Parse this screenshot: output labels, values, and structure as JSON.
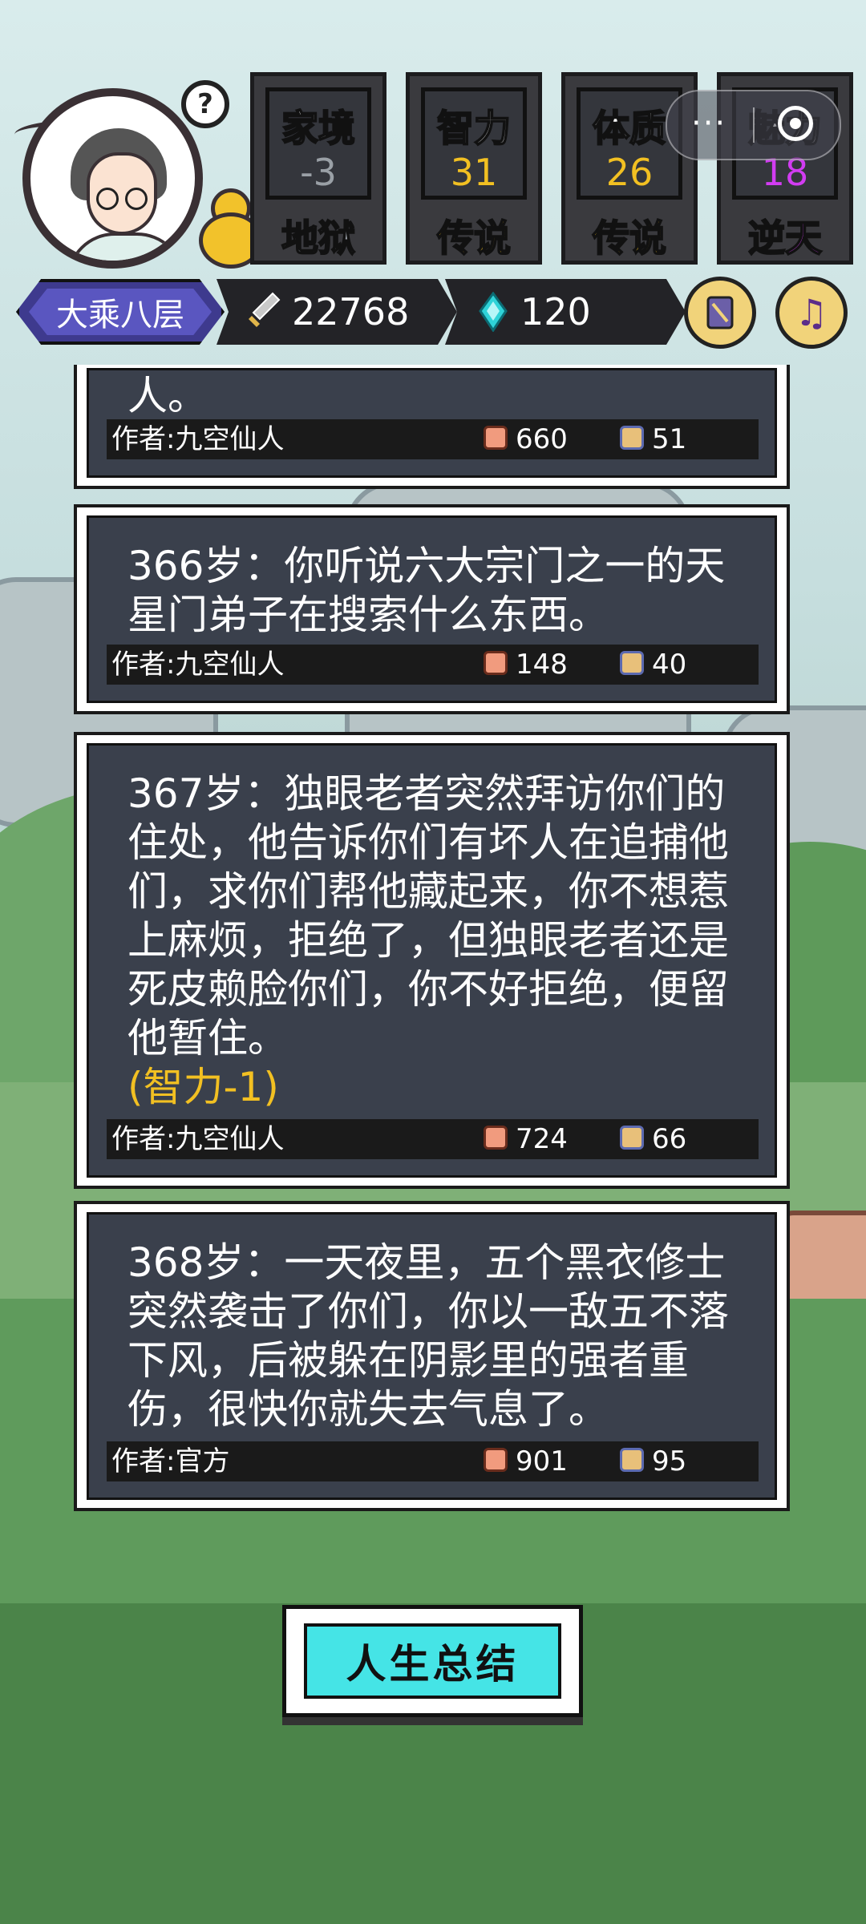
{
  "header": {
    "help_icon": "?",
    "stats": [
      {
        "name": "家境",
        "value": "-3",
        "rank": "地狱",
        "value_color": "#9aa0a6",
        "rank_color": "#9aa0a6"
      },
      {
        "name": "智力",
        "value": "31",
        "rank": "传说",
        "value_color": "#f2c022",
        "rank_color": "#f2c022"
      },
      {
        "name": "体质",
        "value": "26",
        "rank": "传说",
        "value_color": "#f2c022",
        "rank_color": "#f2c022"
      },
      {
        "name": "魅力",
        "value": "18",
        "rank": "逆天",
        "value_color": "#d23cf2",
        "rank_color": "#d23cf2"
      }
    ],
    "mini_program_capsule": {
      "more": "···",
      "close_icon": "target-icon"
    }
  },
  "status": {
    "realm": "大乘八层",
    "sword_power": "22768",
    "spirit_stone": "120",
    "codex_icon": "book-icon",
    "music_icon": "music-note-icon"
  },
  "events": [
    {
      "text": "人。",
      "effect": "",
      "author": "作者:九空仙人",
      "likes": "660",
      "dislikes": "51"
    },
    {
      "text": "366岁：你听说六大宗门之一的天星门弟子在搜索什么东西。",
      "effect": "",
      "author": "作者:九空仙人",
      "likes": "148",
      "dislikes": "40"
    },
    {
      "text": "367岁：独眼老者突然拜访你们的住处，他告诉你们有坏人在追捕他们，求你们帮他藏起来，你不想惹上麻烦，拒绝了，但独眼老者还是死皮赖脸你们，你不好拒绝，便留他暂住。",
      "effect": "(智力-1)",
      "author": "作者:九空仙人",
      "likes": "724",
      "dislikes": "66"
    },
    {
      "text": "368岁：一天夜里，五个黑衣修士突然袭击了你们，你以一敌五不落下风，后被躲在阴影里的强者重伤，很快你就失去气息了。",
      "effect": "",
      "author": "作者:官方",
      "likes": "901",
      "dislikes": "95"
    }
  ],
  "summary_button": "人生总结"
}
